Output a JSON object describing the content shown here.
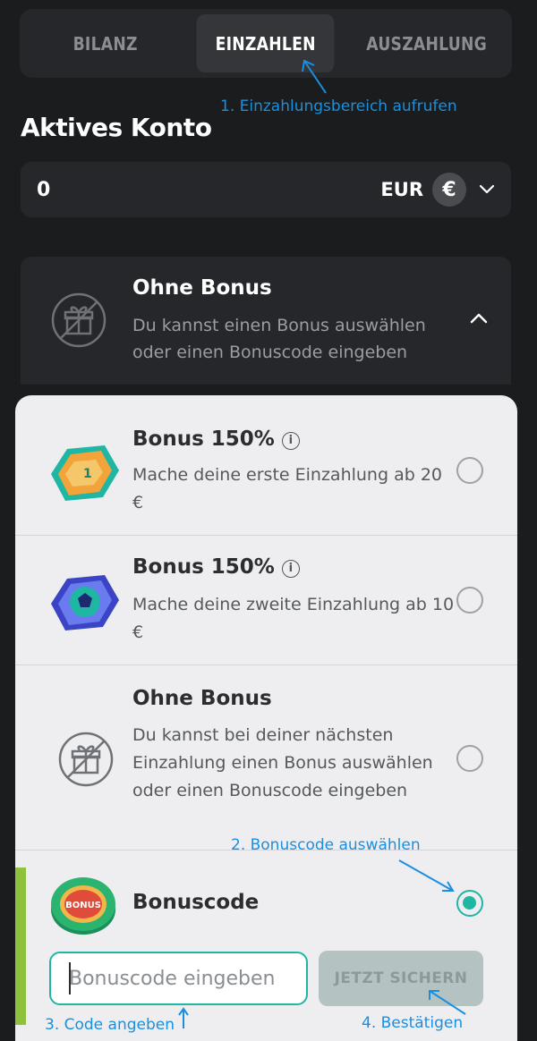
{
  "tabs": [
    {
      "label": "BILANZ",
      "active": false
    },
    {
      "label": "EINZAHLEN",
      "active": true
    },
    {
      "label": "AUSZAHLUNG",
      "active": false
    }
  ],
  "annotations": {
    "step1": "1. Einzahlungsbereich aufrufen",
    "step2": "2. Bonuscode auswählen",
    "step3": "3. Code angeben",
    "step4": "4. Bestätigen"
  },
  "account": {
    "title": "Aktives Konto",
    "balance": "0",
    "currency": "EUR",
    "currency_symbol": "€"
  },
  "bonus_selector": {
    "title": "Ohne Bonus",
    "description": "Du kannst einen Bonus auswählen oder einen Bonuscode eingeben"
  },
  "options": [
    {
      "title": "Bonus 150%",
      "description": "Mache deine erste Einzahlung ab 20 €",
      "icon": "hexagon-trophy-icon",
      "selected": false
    },
    {
      "title": "Bonus 150%",
      "description": "Mache deine zweite Einzahlung ab 10 €",
      "icon": "hexagon-ball-icon",
      "selected": false
    },
    {
      "title": "Ohne Bonus",
      "description": "Du kannst bei deiner nächsten Einzahlung einen Bonus auswählen oder einen Bonuscode eingeben",
      "icon": "no-gift-icon",
      "selected": false
    },
    {
      "title": "Bonuscode",
      "description": "",
      "icon": "bonus-chip-icon",
      "chip_text": "BONUS",
      "selected": true
    }
  ],
  "code_input": {
    "placeholder": "Bonuscode eingeben",
    "value": ""
  },
  "save_label": "JETZT SICHERN",
  "colors": {
    "accent": "#1fb6a3",
    "annotation": "#1a8fe0",
    "background": "#1b1c1e",
    "panel": "#eeeef0",
    "side_bar": "#8ec13c"
  }
}
